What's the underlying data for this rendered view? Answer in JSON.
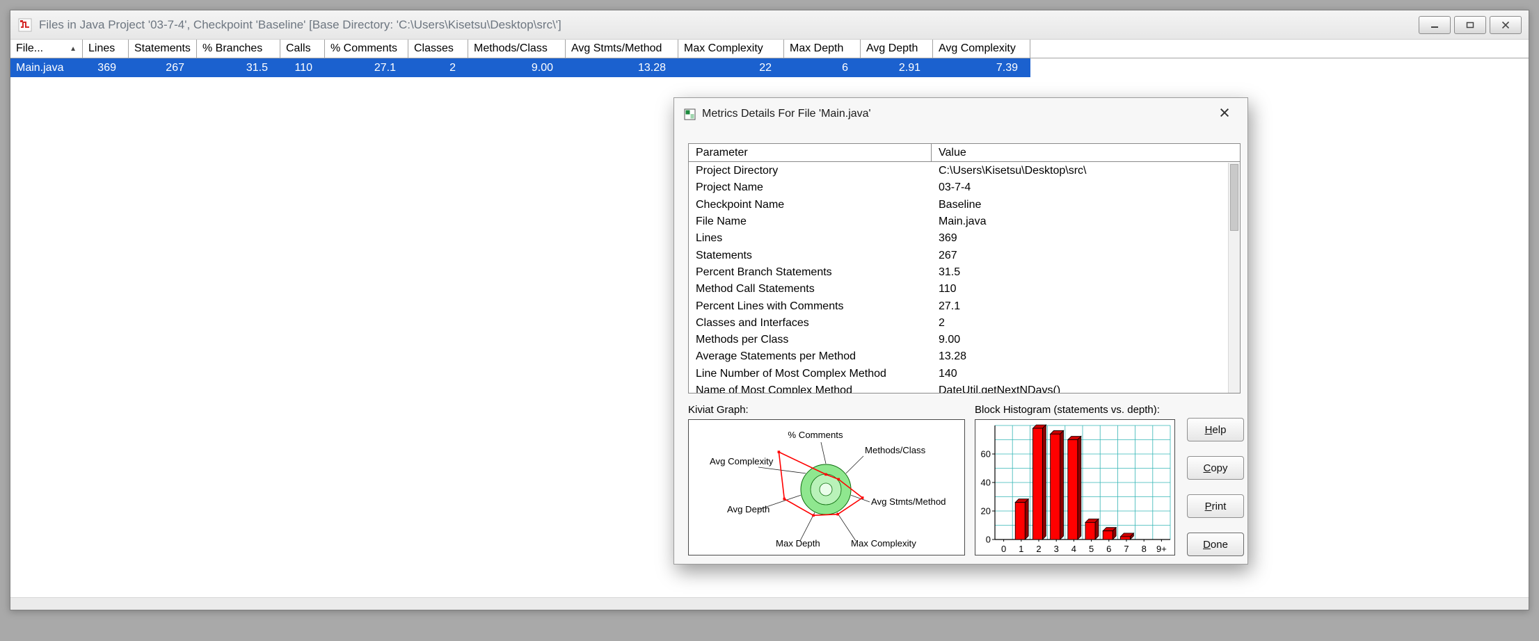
{
  "window": {
    "title": "Files in Java Project '03-7-4', Checkpoint 'Baseline'  [Base Directory: 'C:\\Users\\Kisetsu\\Desktop\\src\\']"
  },
  "colors": {
    "selection": "#1b61cf",
    "selection_text": "#ffffff"
  },
  "file_table": {
    "sort_indicator": "▲",
    "columns": [
      "File...",
      "Lines",
      "Statements",
      "% Branches",
      "Calls",
      "% Comments",
      "Classes",
      "Methods/Class",
      "Avg Stmts/Method",
      "Max Complexity",
      "Max Depth",
      "Avg Depth",
      "Avg Complexity"
    ],
    "rows": [
      [
        "Main.java",
        "369",
        "267",
        "31.5",
        "110",
        "27.1",
        "2",
        "9.00",
        "13.28",
        "22",
        "6",
        "2.91",
        "7.39"
      ]
    ],
    "selected_row": 0
  },
  "dialog": {
    "title": "Metrics Details For File 'Main.java'",
    "close_glyph": "×",
    "table": {
      "headers": [
        "Parameter",
        "Value"
      ]
    },
    "metrics": [
      {
        "param": "Project Directory",
        "value": "C:\\Users\\Kisetsu\\Desktop\\src\\"
      },
      {
        "param": "Project Name",
        "value": "03-7-4"
      },
      {
        "param": "Checkpoint Name",
        "value": "Baseline"
      },
      {
        "param": "File Name",
        "value": "Main.java"
      },
      {
        "param": "Lines",
        "value": "369"
      },
      {
        "param": "Statements",
        "value": "267"
      },
      {
        "param": "Percent Branch Statements",
        "value": "31.5"
      },
      {
        "param": "Method Call Statements",
        "value": "110"
      },
      {
        "param": "Percent Lines with Comments",
        "value": "27.1"
      },
      {
        "param": "Classes and Interfaces",
        "value": "2"
      },
      {
        "param": "Methods per Class",
        "value": "9.00"
      },
      {
        "param": "Average Statements per Method",
        "value": "13.28"
      },
      {
        "param": "Line Number of Most Complex Method",
        "value": "140"
      },
      {
        "param": "Name of Most Complex Method",
        "value": "DateUtil.getNextNDays()"
      }
    ],
    "buttons": [
      {
        "label": "Help"
      },
      {
        "label": "Copy"
      },
      {
        "label": "Print"
      },
      {
        "label": "Done"
      }
    ]
  },
  "chart_data": [
    {
      "type": "radar",
      "title": "Kiviat Graph:",
      "axes": [
        "% Comments",
        "Methods/Class",
        "Avg Stmts/Method",
        "Max Complexity",
        "Max Depth",
        "Avg Depth",
        "Avg Complexity"
      ],
      "values": [
        0.6,
        0.65,
        1.5,
        1.1,
        1.15,
        1.7,
        2.4
      ],
      "ring_fill": "#8fe78f",
      "band_fill": "#b9f2b9",
      "center_fill": "#eafdea",
      "polygon_color": "#ff0000"
    },
    {
      "type": "bar",
      "title": "Block Histogram (statements vs. depth):",
      "categories": [
        "0",
        "1",
        "2",
        "3",
        "4",
        "5",
        "6",
        "7",
        "8",
        "9+"
      ],
      "values": [
        0,
        26,
        78,
        74,
        70,
        12,
        6,
        2,
        0,
        0
      ],
      "ylim": [
        0,
        80
      ],
      "ytick_values": [
        0,
        20,
        40,
        60
      ],
      "bar_color": "#ff0000",
      "grid_color": "#35b6b6"
    }
  ]
}
